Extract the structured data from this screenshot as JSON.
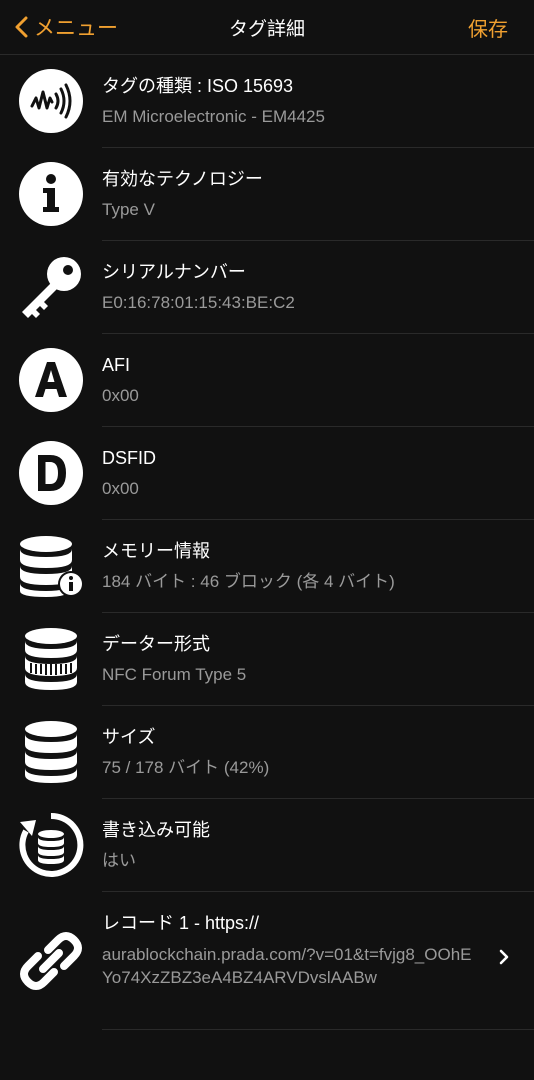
{
  "nav": {
    "back_label": "メニュー",
    "title": "タグ詳細",
    "save_label": "保存"
  },
  "rows": [
    {
      "title": "タグの種類 : ISO 15693",
      "value": "EM Microelectronic - EM4425",
      "icon": "nfc-wave-icon"
    },
    {
      "title": "有効なテクノロジー",
      "value": "Type V",
      "icon": "info-icon"
    },
    {
      "title": "シリアルナンバー",
      "value": "E0:16:78:01:15:43:BE:C2",
      "icon": "key-icon"
    },
    {
      "title": "AFI",
      "value": "0x00",
      "icon": "letter-a-icon"
    },
    {
      "title": "DSFID",
      "value": "0x00",
      "icon": "letter-d-icon"
    },
    {
      "title": "メモリー情報",
      "value": "184 バイト : 46 ブロック (各 4 バイト)",
      "icon": "database-info-icon"
    },
    {
      "title": "データー形式",
      "value": "NFC Forum Type 5",
      "icon": "database-format-icon"
    },
    {
      "title": "サイズ",
      "value": "75 / 178 バイト (42%)",
      "icon": "database-icon"
    },
    {
      "title": "書き込み可能",
      "value": "はい",
      "icon": "database-refresh-icon"
    },
    {
      "title": "レコード 1 - https://",
      "value": "aurablockchain.prada.com/?v=01&t=fvjg8_OOhEYo74XzZBZ3eA4BZ4ARVDvslAABw",
      "icon": "link-icon"
    }
  ],
  "colors": {
    "accent": "#f0a030",
    "background": "#111111",
    "secondary_text": "#9a9a9a"
  }
}
